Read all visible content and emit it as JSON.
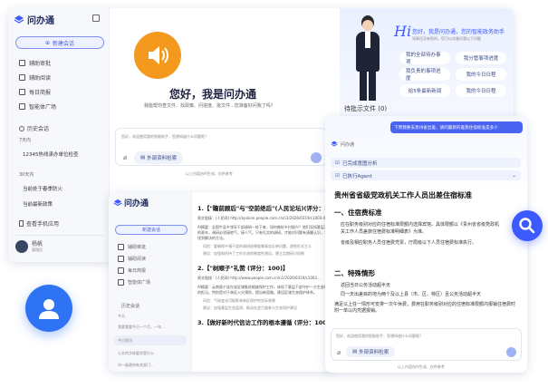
{
  "app": {
    "title": "问办通"
  },
  "sidebar": {
    "new_chat": "新建会话",
    "menu": [
      "辅助审批",
      "辅助阅读",
      "每日简报",
      "智能体广场"
    ],
    "history_title": "历史会话",
    "groups": [
      {
        "label": "7天内",
        "items": [
          "12345热线承办单位检查"
        ]
      },
      {
        "label": "30天内",
        "items": [
          "当前处于春季防火",
          "当前最新政策"
        ]
      }
    ],
    "apps": "查看手机应用",
    "user": {
      "name": "杨帆",
      "role": "管理员"
    }
  },
  "main": {
    "greeting": "您好，我是问办通",
    "subtitle": "我能帮你查文件、找政策、问进度、批文件...您准备好问我了吗？",
    "input_placeholder": "您好，欢迎使用我的智能助手，您想知道什么问题呢？",
    "file_btn": "外部资料检索",
    "footer": "以上内容由AI生成，仅供参考"
  },
  "assistant": {
    "hi": "Hi",
    "headline": "您好，我是问办通，您的智能政务助手",
    "desc": "如果还没有您的，您可以试着问我以下问题",
    "questions": [
      "我的全部待办事项",
      "我分管事项进度",
      "我负责的事项进度",
      "我的今日日程",
      "给5条最新新闻",
      "我的今日日程"
    ],
    "pending": "待批示文件 (0)"
  },
  "news": {
    "sidebar": {
      "new_chat": "新建会话",
      "menu": [
        "辅助审批",
        "辅助阅读",
        "每日简报",
        "智能体广场"
      ],
      "history_title": "历史会话",
      "groups": [
        {
          "label": "今天",
          "items": [
            "我要看看今日一个月、一年..."
          ]
        },
        {
          "label": "",
          "items": [
            "今日资讯",
            "公文的字体要求是什么",
            "市一级政府有关部门..."
          ]
        }
      ]
    },
    "headings": [
      "1.【\"瞻前顾后\"与\"空前绝后\"(人民论坛)(评分：100)】",
      "2.【\"树顺子\"礼赞 (评分：100)】",
      "3.【做好新时代信访工作的根本遵循 (评分：100)】"
    ],
    "item1_source": "原文链接：(人民网) http://opinion.people.com.cn/n1/2026/0319/c1003-40210922.html",
    "item1_summary": "AI摘要：全国牛县乡领导干部调研一轮下来，如何做好乡村振兴？他们深知基层治理的艰辛，调研必须接地气、接人气，只有扎实的调研，才能对问题有清醒认识，才能找到解决的方法。",
    "item1_points": [
      "风险：要确保乡镇干部的调研结果能够真实反映问题，避免形式主义",
      "建议：加强和扶持了工作交流的制度性建设，建立定期研讨机制"
    ],
    "item2_source": "原文链接：(人民网) http://www.people.com.cn/n1/2026/0319/c1003...",
    "item2_summary": "AI摘要：云南昌宁县在该区域推进植被保护工作，体现了基层干部守护一方生态环境的担当，特别是对于林区火灾预防，提出新思路，建设区域生态保护体系。",
    "item2_points": [
      "风险：气候变化可能影响林区保护的实际效果",
      "建议：加强基层生态监测，推动社会力量参与生态保护建设"
    ]
  },
  "answer": {
    "title": "问办通",
    "user_msg": "下周我要去贵州省出差，请问最新的差旅住宿标准是多少",
    "step1": "已完成意图分析",
    "step2": "已执行Agent",
    "doc_title": "贵州省省级党政机关工作人员出差住宿标准",
    "sec1": "一、住宿费标准",
    "sec1_items": [
      "应在职务级别对应的住宿标准限额内选择宾馆。具体限额以《贵州省省级党政机关工作人员差旅住宿费标准明细表》为准。",
      "省级及相应职务人员住宿费凭票，厅局级以下人员住宿费标准执行。"
    ],
    "sec2": "二、特殊情形",
    "sec2_items": [
      "返回当日公务活动超半天",
      "同一天出差目的地为两个及以上县（市、区、特区）且公务活动超半天"
    ],
    "tail": "满足以上任一情形可安排一次午休费，费用在职务级别对应的住宿标准限额内报销住宿费时附一单以内凭据报销。",
    "input_placeholder": "您好，欢迎使用我的智能助手，您想知道什么问题呢？",
    "file_btn": "外部资料检索",
    "footer": "以上内容由AI生成，仅供参考"
  },
  "colors": {
    "primary": "#3d5afe",
    "orange": "#f39a1e",
    "user_avatar": "#2f73f5"
  }
}
